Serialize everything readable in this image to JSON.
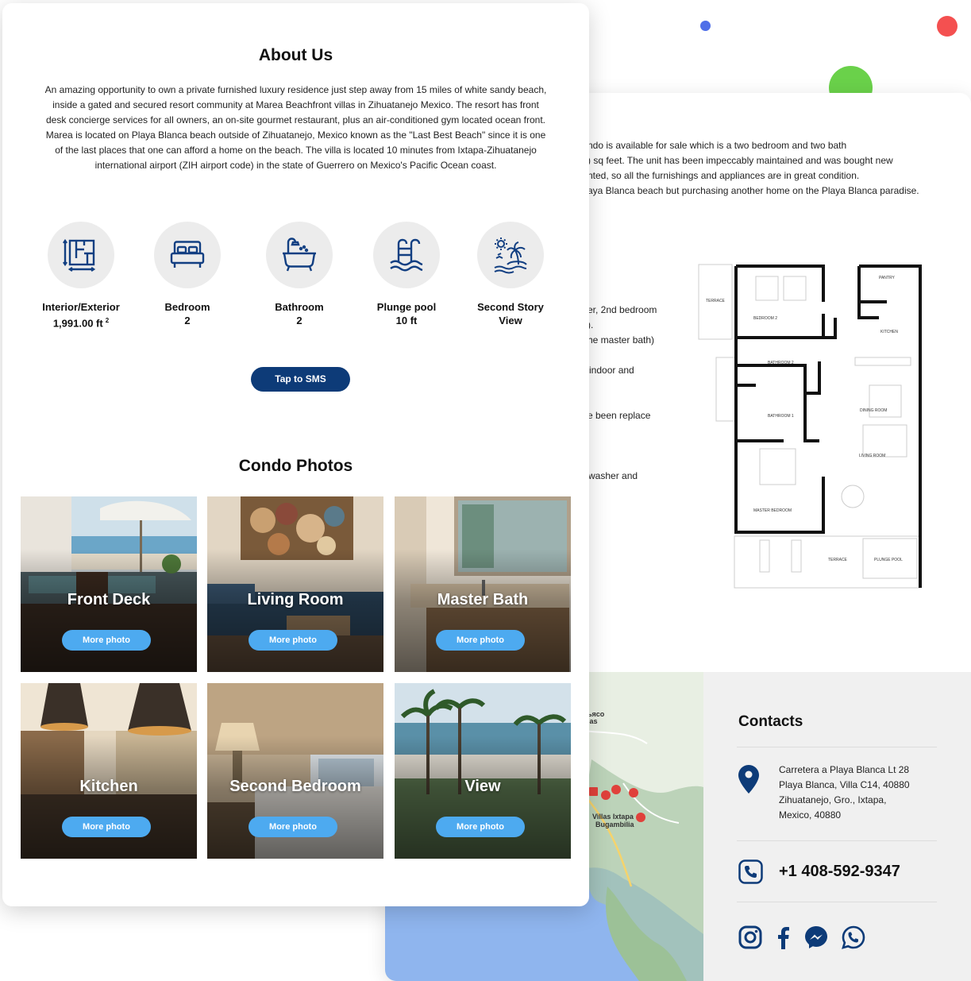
{
  "about": {
    "title": "About Us",
    "text": "An amazing opportunity to own a private furnished luxury residence just step away from 15 miles of white sandy beach, inside a gated and secured resort community at Marea Beachfront villas in Zihuatanejo Mexico. The resort has front desk concierge services for all owners, an on-site gourmet restaurant, plus an air-conditioned gym located ocean front. Marea is located on Playa Blanca beach outside of Zihuatanejo, Mexico known as the \"Last Best Beach\" since it is one of the last places that one can afford a home on the beach. The villa is located 10 minutes from Ixtapa-Zihuatanejo international airport (ZIH airport code) in the state of Guerrero on Mexico's Pacific Ocean coast."
  },
  "features": [
    {
      "label": "Interior/Exterior",
      "value": "1,991.00 ft",
      "sup": "2",
      "icon": "floorplan-icon"
    },
    {
      "label": "Bedroom",
      "value": "2",
      "icon": "bed-icon"
    },
    {
      "label": "Bathroom",
      "value": "2",
      "icon": "bathtub-icon"
    },
    {
      "label": "Plunge pool",
      "value": "10 ft",
      "icon": "pool-icon"
    },
    {
      "label": "Second Story",
      "value": "View",
      "icon": "beach-palm-icon"
    }
  ],
  "sms_button": "Tap to SMS",
  "photos": {
    "title": "Condo Photos",
    "more_label": "More photo",
    "tiles": [
      {
        "title": "Front Deck"
      },
      {
        "title": "Living Room"
      },
      {
        "title": "Master Bath"
      },
      {
        "title": "Kitchen"
      },
      {
        "title": "Second Bedroom"
      },
      {
        "title": "View"
      }
    ]
  },
  "back": {
    "lines": [
      "ndo is available for sale which is a two bedroom and two bath",
      ") sq feet. The unit has been impeccably maintained and was bought new",
      "nted, so all the furnishings and appliances are in great condition.",
      "aya Blanca beach but purchasing another home on the Playa Blanca paradise."
    ],
    "fragments": [
      "er, 2nd bedroom",
      ").",
      "he master bath)",
      "indoor and",
      "e been replace",
      "washer and"
    ],
    "floorplan_labels": [
      "TERRACE",
      "BEDROOM 2",
      "PANTRY",
      "KITCHEN",
      "BATHROOM 2",
      "BATHROOM 1",
      "DINING ROOM",
      "LIVING ROOM",
      "MASTER BEDROOM",
      "TERRACE",
      "PLUNGE POOL"
    ]
  },
  "map": {
    "labels": [
      "ьясо",
      "las",
      "Villas Ixtapa",
      "Bugambilia"
    ]
  },
  "contacts": {
    "title": "Contacts",
    "address": [
      "Carretera a Playa Blanca Lt 28",
      "Playa Blanca, Villa C14, 40880",
      "Zihuatanejo, Gro., Ixtapa,",
      "Mexico, 40880"
    ],
    "phone": "+1 408-592-9347",
    "social": [
      "instagram-icon",
      "facebook-icon",
      "messenger-icon",
      "whatsapp-icon"
    ]
  },
  "colors": {
    "navy": "#0d3b78",
    "sky_button": "#4daaf0",
    "icon_blue": "#123f82",
    "dot_blue": "#4f6fe8",
    "dot_red": "#f45050",
    "dot_green": "#6ad14a"
  }
}
